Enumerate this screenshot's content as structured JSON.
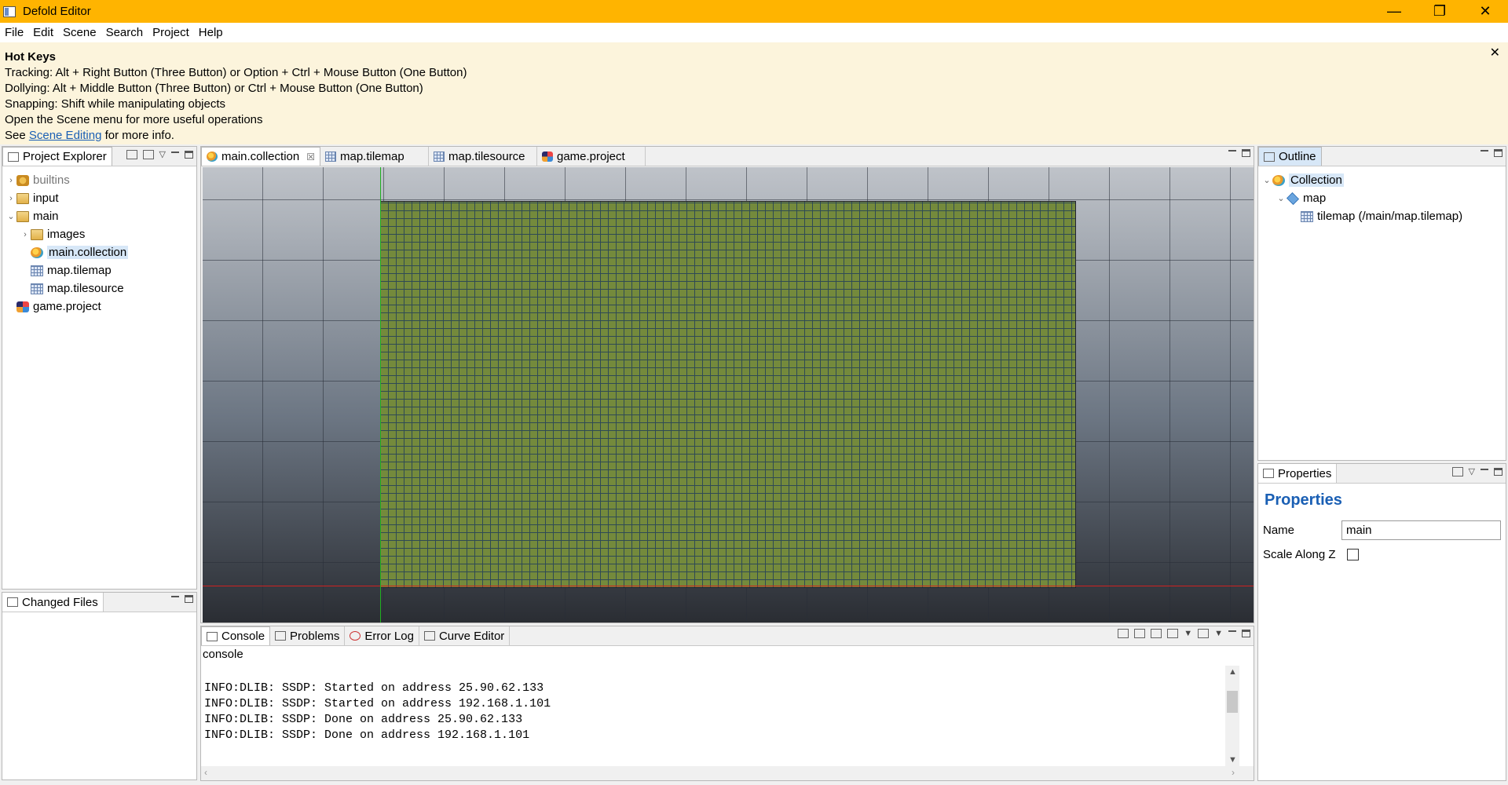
{
  "window": {
    "title": "Defold Editor",
    "minimize": "—",
    "restore": "❐",
    "close": "✕"
  },
  "menu": [
    "File",
    "Edit",
    "Scene",
    "Search",
    "Project",
    "Help"
  ],
  "hotkeys": {
    "title": "Hot Keys",
    "lines": [
      "Tracking: Alt + Right Button (Three Button) or Option + Ctrl + Mouse Button (One Button)",
      "Dollying: Alt + Middle Button (Three Button) or Ctrl + Mouse Button (One Button)",
      "Snapping: Shift while manipulating objects",
      "Open the Scene menu for more useful operations"
    ],
    "see_prefix": "See ",
    "see_link": "Scene Editing",
    "see_suffix": " for more info.",
    "close": "✕"
  },
  "project_explorer": {
    "tab": "Project Explorer",
    "items": [
      {
        "label": "builtins",
        "depth": 0,
        "arrow": "›",
        "icon": "builtins-icon"
      },
      {
        "label": "input",
        "depth": 0,
        "arrow": "›",
        "icon": "folder-icon"
      },
      {
        "label": "main",
        "depth": 0,
        "arrow": "⌄",
        "icon": "folder-icon"
      },
      {
        "label": "images",
        "depth": 1,
        "arrow": "›",
        "icon": "folder-icon"
      },
      {
        "label": "main.collection",
        "depth": 1,
        "arrow": "",
        "icon": "collection-icon",
        "selected": true
      },
      {
        "label": "map.tilemap",
        "depth": 1,
        "arrow": "",
        "icon": "tilemap-icon"
      },
      {
        "label": "map.tilesource",
        "depth": 1,
        "arrow": "",
        "icon": "tilesource-icon"
      },
      {
        "label": "game.project",
        "depth": 0,
        "arrow": "",
        "icon": "project-icon"
      }
    ]
  },
  "changed_files": {
    "tab": "Changed Files"
  },
  "editor_tabs": [
    {
      "label": "main.collection",
      "active": true,
      "close": "☒"
    },
    {
      "label": "map.tilemap"
    },
    {
      "label": "map.tilesource"
    },
    {
      "label": "game.project"
    }
  ],
  "console_tabs": [
    "Console",
    "Problems",
    "Error Log",
    "Curve Editor"
  ],
  "console": {
    "header": "console",
    "lines": [
      "INFO:DLIB: SSDP: Started on address 25.90.62.133",
      "INFO:DLIB: SSDP: Started on address 192.168.1.101",
      "INFO:DLIB: SSDP: Done on address 25.90.62.133",
      "INFO:DLIB: SSDP: Done on address 192.168.1.101"
    ]
  },
  "outline": {
    "tab": "Outline",
    "items": [
      {
        "label": "Collection",
        "depth": 0,
        "arrow": "⌄",
        "icon": "collection-icon",
        "selected": true
      },
      {
        "label": "map",
        "depth": 1,
        "arrow": "⌄",
        "icon": "game-object-icon"
      },
      {
        "label": "tilemap (/main/map.tilemap)",
        "depth": 2,
        "arrow": "",
        "icon": "tilemap-icon"
      }
    ]
  },
  "properties": {
    "tab": "Properties",
    "heading": "Properties",
    "name_label": "Name",
    "name_value": "main",
    "scale_label": "Scale Along Z",
    "scale_checked": false
  }
}
